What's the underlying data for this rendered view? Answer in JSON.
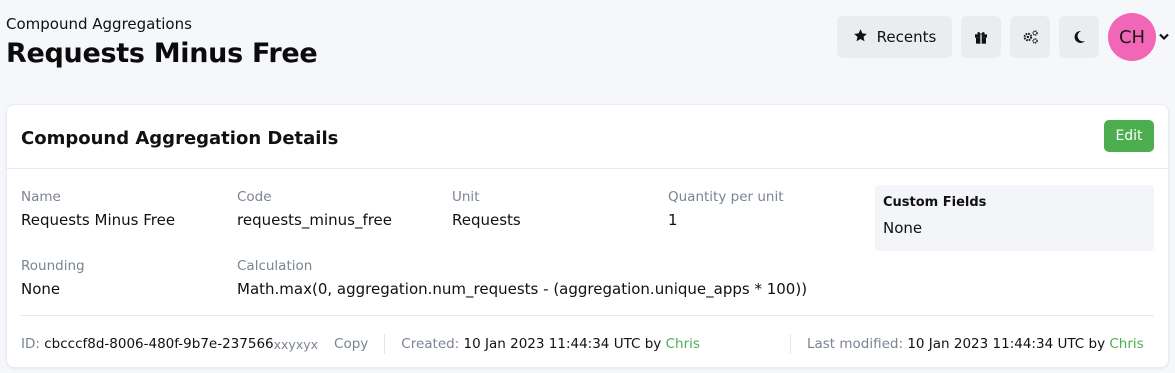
{
  "header": {
    "breadcrumb": "Compound Aggregations",
    "title": "Requests Minus Free",
    "recents_label": "Recents",
    "avatar_initials": "CH",
    "icons": [
      "star-icon",
      "gift-icon",
      "cogs-icon",
      "moon-icon",
      "chevron-down-icon"
    ]
  },
  "card": {
    "title": "Compound Aggregation Details",
    "edit_label": "Edit",
    "fields": {
      "name": {
        "label": "Name",
        "value": "Requests Minus Free"
      },
      "code": {
        "label": "Code",
        "value": "requests_minus_free"
      },
      "unit": {
        "label": "Unit",
        "value": "Requests"
      },
      "quantity": {
        "label": "Quantity per unit",
        "value": "1"
      },
      "rounding": {
        "label": "Rounding",
        "value": "None"
      },
      "calculation": {
        "label": "Calculation",
        "value": "Math.max(0, aggregation.num_requests - (aggregation.unique_apps * 100))"
      }
    },
    "custom_fields": {
      "title": "Custom Fields",
      "value": "None"
    },
    "footer": {
      "id_label": "ID:",
      "id_value": "cbcccf8d-8006-480f-9b7e-237566",
      "id_suffix": "xxyxyx",
      "copy_label": "Copy",
      "created_label": "Created:",
      "created_value": "10 Jan 2023 11:44:34 UTC by",
      "created_by": "Chris",
      "modified_label": "Last modified:",
      "modified_value": "10 Jan 2023 11:44:34 UTC by",
      "modified_by": "Chris"
    }
  },
  "colors": {
    "accent": "#4cae4f",
    "avatar": "#f266b8",
    "background": "#f5f7fa"
  }
}
